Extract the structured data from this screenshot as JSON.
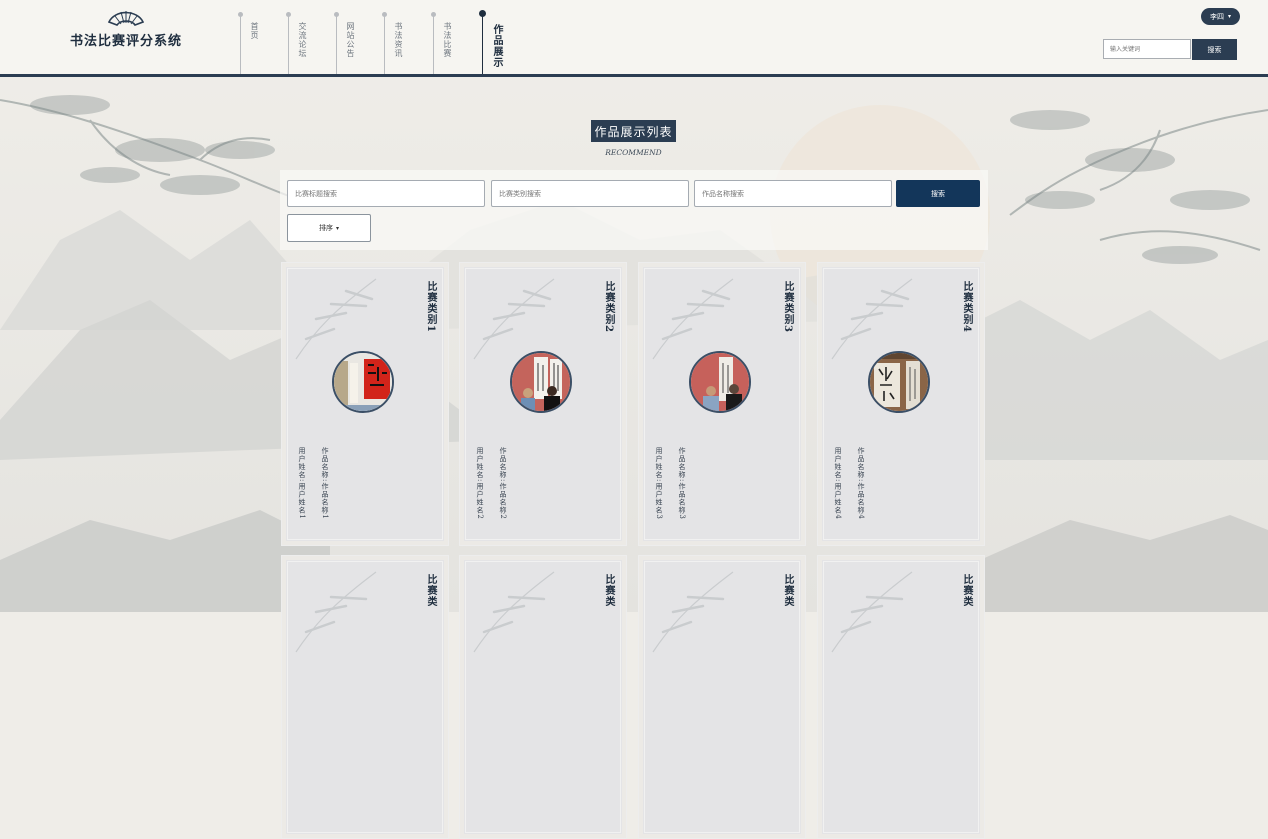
{
  "app": {
    "title": "书法比赛评分系统"
  },
  "nav": {
    "items": [
      {
        "label": "首页",
        "active": false
      },
      {
        "label": "交流论坛",
        "active": false
      },
      {
        "label": "网站公告",
        "active": false
      },
      {
        "label": "书法资讯",
        "active": false
      },
      {
        "label": "书法比赛",
        "active": false
      },
      {
        "label": "作品展示",
        "active": true
      }
    ]
  },
  "header": {
    "user_label": "李四",
    "search_placeholder": "输入关键词",
    "search_button": "搜索"
  },
  "main": {
    "section_title": "作品展示列表",
    "section_subtitle": "RECOMMEND",
    "filters": {
      "contest_title_placeholder": "比赛标题搜索",
      "contest_category_placeholder": "比赛类别搜索",
      "work_name_placeholder": "作品名称搜索",
      "search_button": "搜索",
      "sort_button": "排序"
    },
    "cards": [
      {
        "category": "比赛类别1",
        "work": "作品名称:作品名称1",
        "user": "用户姓名:用户姓名1",
        "photo": "red-calligraphy-wall"
      },
      {
        "category": "比赛类别2",
        "work": "作品名称:作品名称2",
        "user": "用户姓名:用户姓名2",
        "photo": "visitors-at-gallery"
      },
      {
        "category": "比赛类别3",
        "work": "作品名称:作品名称3",
        "user": "用户姓名:用户姓名3",
        "photo": "visitors-at-gallery"
      },
      {
        "category": "比赛类别4",
        "work": "作品名称:作品名称4",
        "user": "用户姓名:用户姓名4",
        "photo": "calligraphy-scroll"
      },
      {
        "category": "比赛类",
        "work": "",
        "user": "",
        "photo": ""
      },
      {
        "category": "比赛类",
        "work": "",
        "user": "",
        "photo": ""
      },
      {
        "category": "比赛类",
        "work": "",
        "user": "",
        "photo": ""
      },
      {
        "category": "比赛类",
        "work": "",
        "user": "",
        "photo": ""
      }
    ]
  },
  "colors": {
    "primary": "#2b3d52",
    "button": "#13365a",
    "background": "#efede8",
    "card": "#e4e4e6"
  }
}
